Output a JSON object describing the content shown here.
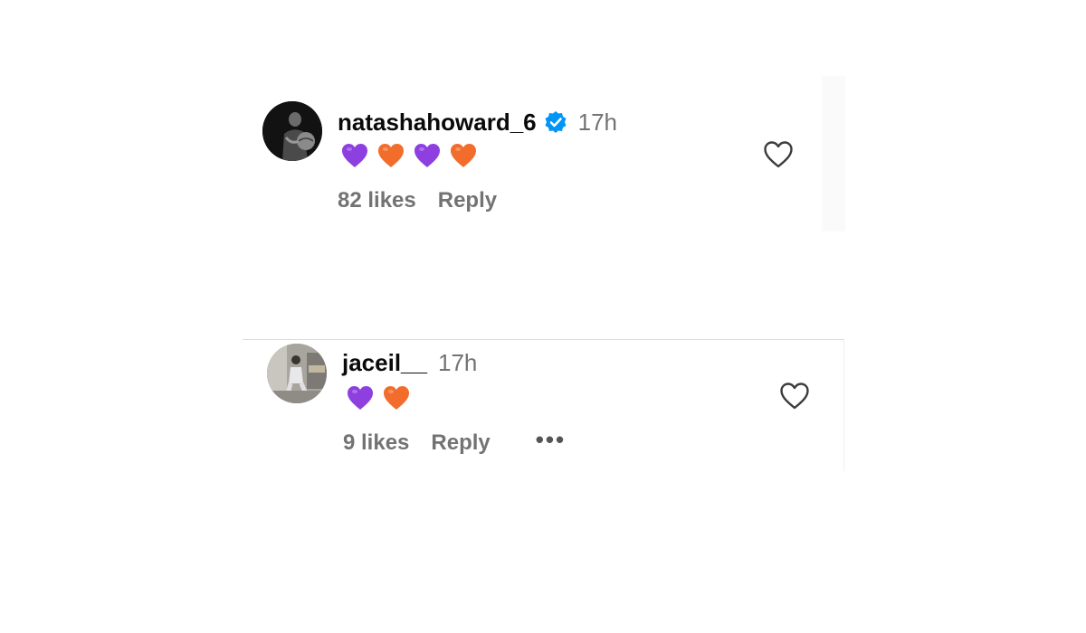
{
  "comments": [
    {
      "username": "natashahoward_6",
      "verified": true,
      "time": "17h",
      "emojis": [
        "purple-heart",
        "orange-heart",
        "purple-heart",
        "orange-heart"
      ],
      "likes": "82 likes",
      "reply_label": "Reply"
    },
    {
      "username": "jaceil__",
      "verified": false,
      "time": "17h",
      "emojis": [
        "purple-heart",
        "orange-heart"
      ],
      "likes": "9 likes",
      "reply_label": "Reply",
      "more_label": "•••"
    }
  ],
  "colors": {
    "purple_heart": "#8e3fe0",
    "orange_heart": "#f26d2b",
    "verified_blue": "#0095f6",
    "muted_text": "#737373"
  }
}
